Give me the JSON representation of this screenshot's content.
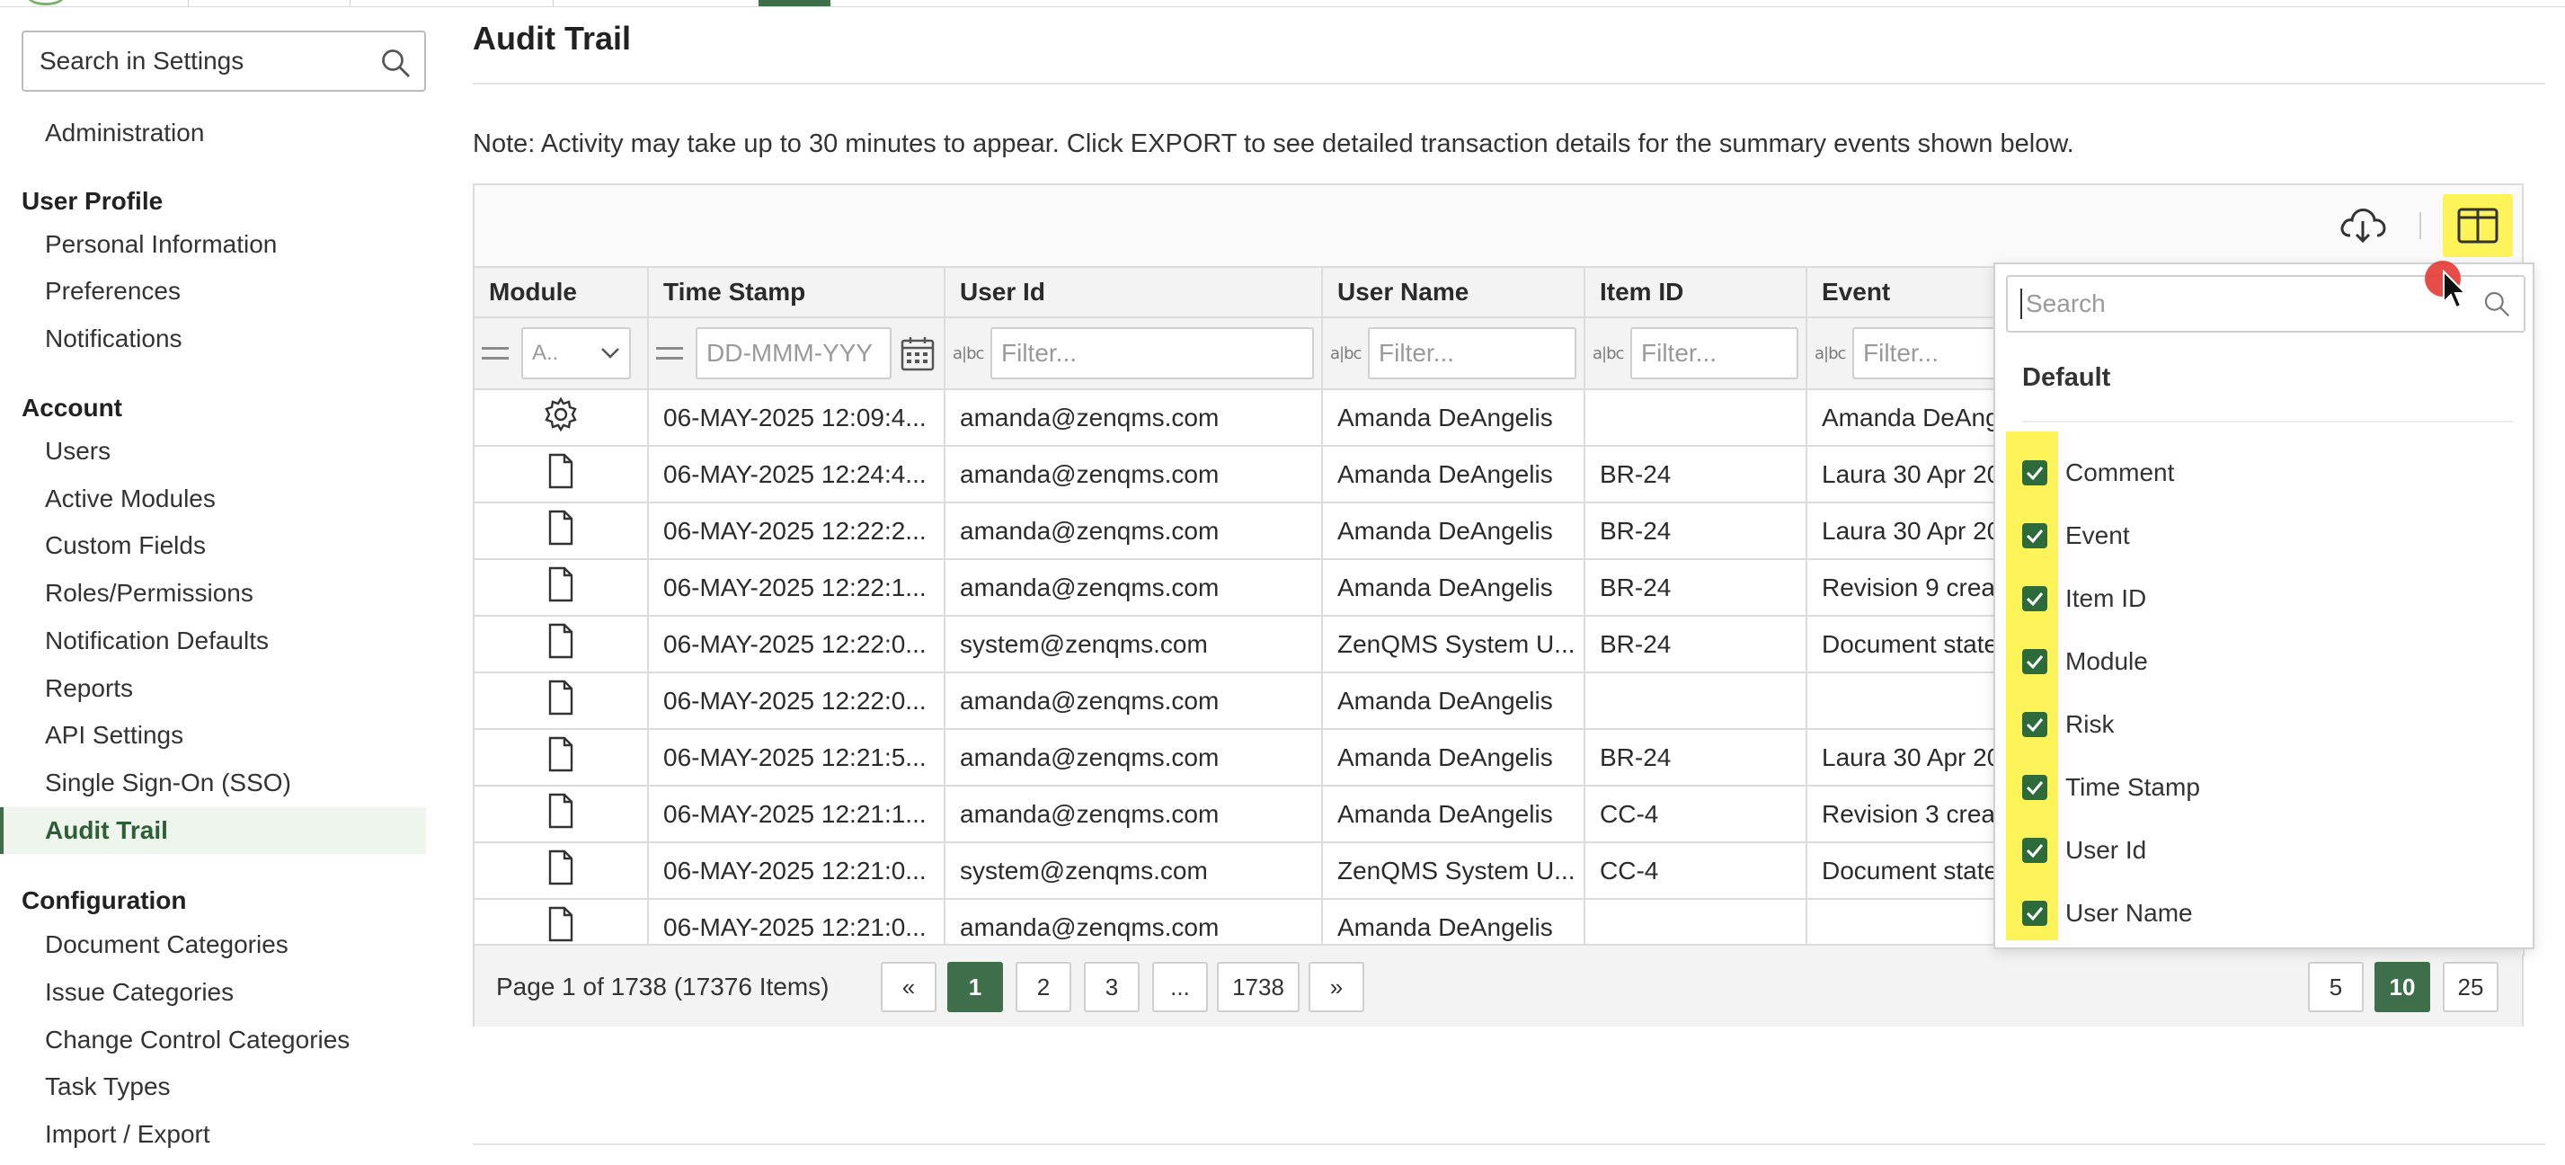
{
  "sidebar": {
    "search_label": "Search in Settings",
    "administration": "Administration",
    "groups": [
      {
        "heading": "User Profile",
        "items": [
          "Personal Information",
          "Preferences",
          "Notifications"
        ]
      },
      {
        "heading": "Account",
        "items": [
          "Users",
          "Active Modules",
          "Custom Fields",
          "Roles/Permissions",
          "Notification Defaults",
          "Reports",
          "API Settings",
          "Single Sign-On (SSO)",
          "Audit Trail"
        ]
      },
      {
        "heading": "Configuration",
        "items": [
          "Document Categories",
          "Issue Categories",
          "Change Control Categories",
          "Task Types",
          "Import / Export"
        ]
      }
    ],
    "active_item": "Audit Trail"
  },
  "main": {
    "title": "Audit Trail",
    "note": "Note: Activity may take up to 30 minutes to appear. Click EXPORT to see detailed transaction details for the summary events shown below."
  },
  "table": {
    "columns": [
      "Module",
      "Time Stamp",
      "User Id",
      "User Name",
      "Item ID",
      "Event"
    ],
    "filters": {
      "module_select": "A..",
      "date_placeholder": "DD-MMM-YYY",
      "text_placeholder": "Filter..."
    },
    "rows": [
      {
        "icon": "gear-icon",
        "time": "06-MAY-2025 12:09:4...",
        "user_id": "amanda@zenqms.com",
        "user_name": "Amanda DeAngelis",
        "item_id": "",
        "event": "Amanda DeAng"
      },
      {
        "icon": "document-icon",
        "time": "06-MAY-2025 12:24:4...",
        "user_id": "amanda@zenqms.com",
        "user_name": "Amanda DeAngelis",
        "item_id": "BR-24",
        "event": "Laura 30 Apr 20"
      },
      {
        "icon": "document-icon",
        "time": "06-MAY-2025 12:22:2...",
        "user_id": "amanda@zenqms.com",
        "user_name": "Amanda DeAngelis",
        "item_id": "BR-24",
        "event": "Laura 30 Apr 20"
      },
      {
        "icon": "document-icon",
        "time": "06-MAY-2025 12:22:1...",
        "user_id": "amanda@zenqms.com",
        "user_name": "Amanda DeAngelis",
        "item_id": "BR-24",
        "event": "Revision 9 creat"
      },
      {
        "icon": "document-icon",
        "time": "06-MAY-2025 12:22:0...",
        "user_id": "system@zenqms.com",
        "user_name": "ZenQMS System U...",
        "item_id": "BR-24",
        "event": "Document state"
      },
      {
        "icon": "document-icon",
        "time": "06-MAY-2025 12:22:0...",
        "user_id": "amanda@zenqms.com",
        "user_name": "Amanda DeAngelis",
        "item_id": "",
        "event": ""
      },
      {
        "icon": "document-icon",
        "time": "06-MAY-2025 12:21:5...",
        "user_id": "amanda@zenqms.com",
        "user_name": "Amanda DeAngelis",
        "item_id": "BR-24",
        "event": "Laura 30 Apr 20"
      },
      {
        "icon": "document-icon",
        "time": "06-MAY-2025 12:21:1...",
        "user_id": "amanda@zenqms.com",
        "user_name": "Amanda DeAngelis",
        "item_id": "CC-4",
        "event": "Revision 3 creat"
      },
      {
        "icon": "document-icon",
        "time": "06-MAY-2025 12:21:0...",
        "user_id": "system@zenqms.com",
        "user_name": "ZenQMS System U...",
        "item_id": "CC-4",
        "event": "Document state"
      },
      {
        "icon": "document-icon",
        "time": "06-MAY-2025 12:21:0...",
        "user_id": "amanda@zenqms.com",
        "user_name": "Amanda DeAngelis",
        "item_id": "",
        "event": ""
      }
    ]
  },
  "pager": {
    "info": "Page 1 of 1738 (17376 Items)",
    "first": "«",
    "pages": [
      "1",
      "2",
      "3",
      "...",
      "1738"
    ],
    "last": "»",
    "current_page": "1",
    "sizes": [
      "5",
      "10",
      "25"
    ],
    "current_size": "10"
  },
  "chooser": {
    "search_placeholder": "Search",
    "group_heading": "Default",
    "items": [
      "Comment",
      "Event",
      "Item ID",
      "Module",
      "Risk",
      "Time Stamp",
      "User Id",
      "User Name"
    ],
    "all_checked": true
  },
  "colors": {
    "accent": "#3f6f4a",
    "highlight": "#fff35a",
    "checkbox": "#2e6b3a",
    "cursor_dot": "#e53935"
  }
}
